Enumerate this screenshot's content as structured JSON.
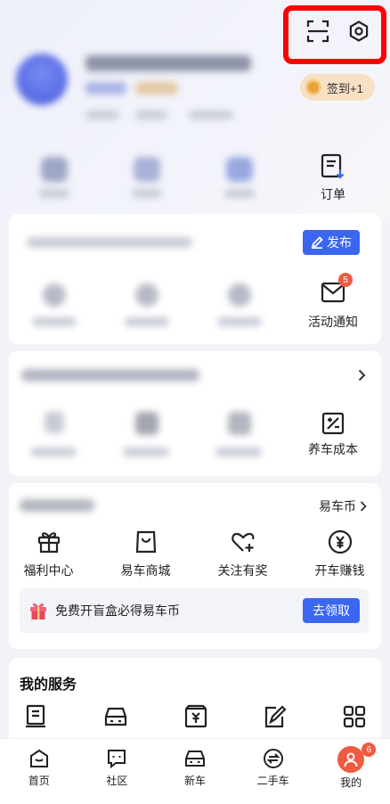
{
  "header": {
    "scan_icon": "scan-icon",
    "settings_icon": "settings-icon",
    "signin_label": "签到+1"
  },
  "right_column": {
    "orders_label": "订单",
    "publish_label": "发布",
    "activity_label": "活动通知",
    "activity_badge": "5",
    "car_cost_label": "养车成本"
  },
  "coin_section": {
    "link_label": "易车币",
    "items": [
      {
        "label": "福利中心",
        "icon": "gift-icon"
      },
      {
        "label": "易车商城",
        "icon": "shopping-bag-icon"
      },
      {
        "label": "关注有奖",
        "icon": "heart-plus-icon"
      },
      {
        "label": "开车赚钱",
        "icon": "yuan-coin-icon"
      }
    ],
    "banner_text": "免费开盲盒必得易车币",
    "banner_button": "去领取"
  },
  "services": {
    "title": "我的服务",
    "icons": [
      "id-card-icon",
      "car-icon",
      "wallet-icon",
      "edit-note-icon",
      "grid-apps-icon"
    ]
  },
  "tabbar": {
    "items": [
      {
        "label": "首页",
        "icon": "home-icon"
      },
      {
        "label": "社区",
        "icon": "chat-icon"
      },
      {
        "label": "新车",
        "icon": "car-icon"
      },
      {
        "label": "二手车",
        "icon": "exchange-icon"
      },
      {
        "label": "我的",
        "icon": "profile-icon"
      }
    ],
    "profile_badge": "6"
  },
  "colors": {
    "accent_blue": "#3b66f0",
    "badge_red": "#ef5a40",
    "highlight_red": "#ff0000"
  }
}
